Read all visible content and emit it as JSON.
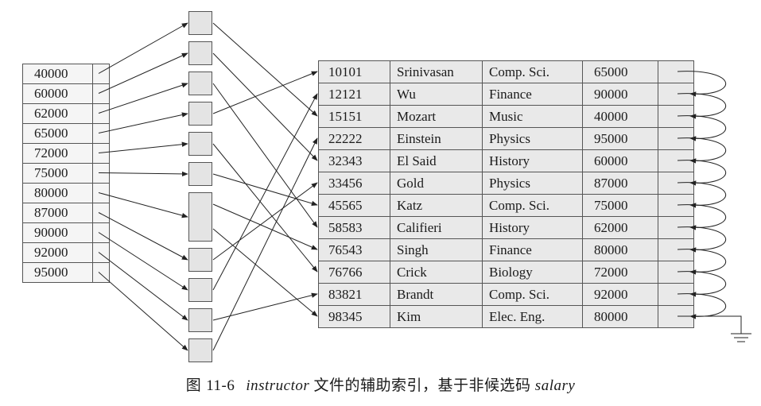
{
  "index": {
    "keys": [
      "40000",
      "60000",
      "62000",
      "65000",
      "72000",
      "75000",
      "80000",
      "87000",
      "90000",
      "92000",
      "95000"
    ]
  },
  "file": {
    "rows": [
      {
        "id": "10101",
        "name": "Srinivasan",
        "dept": "Comp. Sci.",
        "salary": "65000"
      },
      {
        "id": "12121",
        "name": "Wu",
        "dept": "Finance",
        "salary": "90000"
      },
      {
        "id": "15151",
        "name": "Mozart",
        "dept": "Music",
        "salary": "40000"
      },
      {
        "id": "22222",
        "name": "Einstein",
        "dept": "Physics",
        "salary": "95000"
      },
      {
        "id": "32343",
        "name": "El Said",
        "dept": "History",
        "salary": "60000"
      },
      {
        "id": "33456",
        "name": "Gold",
        "dept": "Physics",
        "salary": "87000"
      },
      {
        "id": "45565",
        "name": "Katz",
        "dept": "Comp. Sci.",
        "salary": "75000"
      },
      {
        "id": "58583",
        "name": "Califieri",
        "dept": "History",
        "salary": "62000"
      },
      {
        "id": "76543",
        "name": "Singh",
        "dept": "Finance",
        "salary": "80000"
      },
      {
        "id": "76766",
        "name": "Crick",
        "dept": "Biology",
        "salary": "72000"
      },
      {
        "id": "83821",
        "name": "Brandt",
        "dept": "Comp. Sci.",
        "salary": "92000"
      },
      {
        "id": "98345",
        "name": "Kim",
        "dept": "Elec. Eng.",
        "salary": "80000"
      }
    ]
  },
  "caption": {
    "figure": "图",
    "number": "11-6",
    "relation": "instructor",
    "text": "文件的辅助索引，基于非候选码",
    "attribute": "salary"
  },
  "colors": {
    "line": "#222222",
    "fill_file": "#e9e9e9",
    "fill_bucket": "#e4e4e4"
  }
}
